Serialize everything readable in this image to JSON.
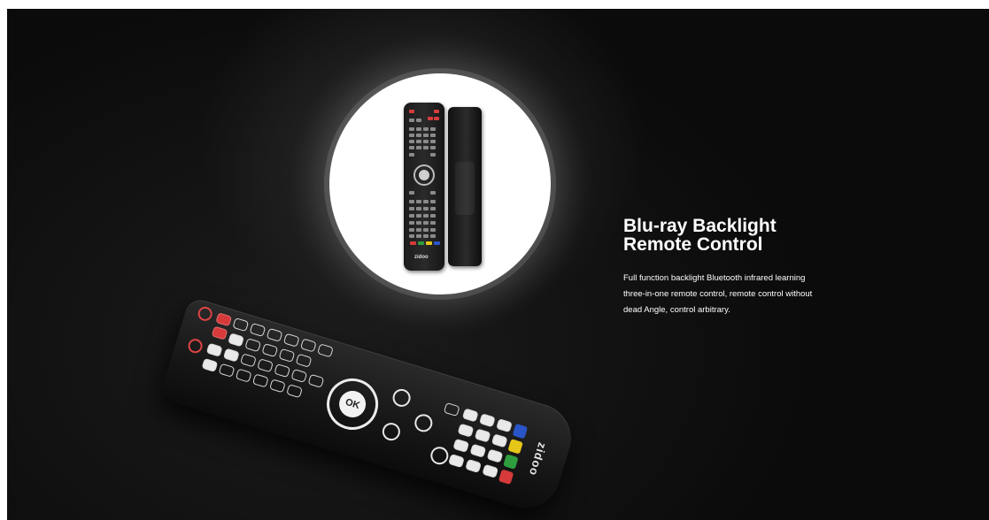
{
  "headline": {
    "line1": "Blu-ray Backlight",
    "line2": "Remote Control"
  },
  "description": "Full function backlight Bluetooth infrared learning three-in-one remote control, remote control without dead Angle, control arbitrary.",
  "remote_front": {
    "brand": "zidoo"
  },
  "remote_big": {
    "ok_label": "OK",
    "brand": "zidoo"
  },
  "colors": {
    "background": "#0b0b0b",
    "text": "#ffffff",
    "key_red": "#d63a3a",
    "key_green": "#2e9e3f",
    "key_yellow": "#e6c619",
    "key_blue": "#2a55c9"
  },
  "icons": [
    "power-icon",
    "ok-dpad-icon",
    "color-key-icons"
  ]
}
